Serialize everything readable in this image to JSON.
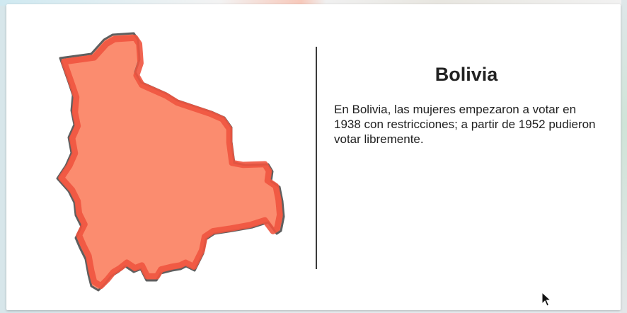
{
  "slide": {
    "title": "Bolivia",
    "description": "En Bolivia, las mujeres empezaron a votar en 1938 con restricciones; a partir de 1952 pudieron votar libremente."
  },
  "map": {
    "icon": "bolivia-map-icon",
    "fill_color": "#fb8c6f",
    "border_color": "#f0543f",
    "outline_color": "#5f5f5f"
  },
  "cursor": {
    "icon": "mouse-pointer-icon"
  }
}
